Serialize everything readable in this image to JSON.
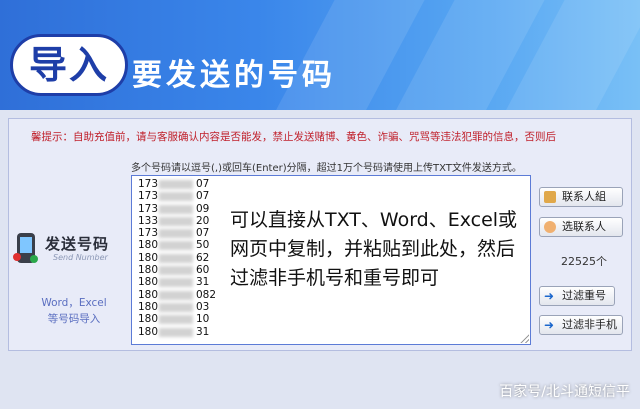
{
  "header": {
    "badge_text": "导入",
    "headline": "要发送的号码"
  },
  "panel": {
    "notice": "馨提示：自助充值前，请与客服确认内容是否能发，禁止发送赌博、黄色、诈骗、咒骂等违法犯罪的信息，否则后",
    "hint": "多个号码请以逗号(,)或回车(Enter)分隔，超过1万个号码请使用上传TXT文件发送方式。",
    "logo_title": "发送号码",
    "logo_sub": "Send Number",
    "left_note_line1": "Word，Excel",
    "left_note_line2": "等号码导入"
  },
  "numbers": [
    {
      "prefix": "173",
      "suffix": "07"
    },
    {
      "prefix": "173",
      "suffix": "07"
    },
    {
      "prefix": "173",
      "suffix": "09"
    },
    {
      "prefix": "133",
      "suffix": "20"
    },
    {
      "prefix": "173",
      "suffix": "07"
    },
    {
      "prefix": "180",
      "suffix": "50"
    },
    {
      "prefix": "180",
      "suffix": "62"
    },
    {
      "prefix": "180",
      "suffix": "60"
    },
    {
      "prefix": "180",
      "suffix": "31"
    },
    {
      "prefix": "180",
      "suffix": "082"
    },
    {
      "prefix": "180",
      "suffix": "03"
    },
    {
      "prefix": "180",
      "suffix": "10"
    },
    {
      "prefix": "180",
      "suffix": "31"
    }
  ],
  "overlay_text": "可以直接从TXT、Word、Excel或网页中复制，并粘贴到此处，然后过滤非手机号和重号即可",
  "buttons": {
    "contacts_group": "联系人組",
    "select_contacts": "选联系人",
    "dedupe": "过滤重号",
    "filter_non_mobile": "过滤非手机"
  },
  "count_label": "22525个",
  "watermark": "百家号/北斗通短信平"
}
